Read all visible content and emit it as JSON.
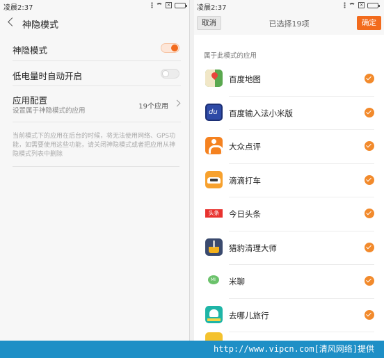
{
  "left": {
    "status_time": "凌晨2:37",
    "title": "神隐模式",
    "rows": [
      {
        "label": "神隐模式"
      },
      {
        "label": "低电量时自动开启"
      },
      {
        "label": "应用配置",
        "sublabel": "设置属于神隐模式的应用",
        "count": "19个应用"
      }
    ],
    "toggles": {
      "stealth_mode": true,
      "low_battery_auto": false
    },
    "description": "当前模式下的应用在后台的时候，将无法使用网络、GPS功能，如需要使用这些功能，请关闭神隐模式或者把应用从神隐模式列表中删除"
  },
  "right": {
    "status_time": "凌晨2:37",
    "cancel_label": "取消",
    "title": "已选择19项",
    "ok_label": "确定",
    "section_label": "属于此模式的应用",
    "apps": [
      {
        "name": "百度地图",
        "icon": "baidu-map-icon",
        "checked": true
      },
      {
        "name": "百度输入法小米版",
        "icon": "baidu-input-icon",
        "checked": true,
        "icon_text": "du"
      },
      {
        "name": "大众点评",
        "icon": "dianping-icon",
        "checked": true
      },
      {
        "name": "滴滴打车",
        "icon": "didi-icon",
        "checked": true
      },
      {
        "name": "今日头条",
        "icon": "toutiao-icon",
        "checked": true,
        "icon_text": "头条"
      },
      {
        "name": "猎豹清理大师",
        "icon": "cheetah-clean-icon",
        "checked": true
      },
      {
        "name": "米聊",
        "icon": "miliao-icon",
        "checked": true,
        "icon_text": "MI"
      },
      {
        "name": "去哪儿旅行",
        "icon": "qunar-icon",
        "checked": true
      }
    ]
  },
  "watermark": "http://www.vipcn.com[清风网络]提供",
  "colors": {
    "accent": "#f26b1d",
    "check": "#f28a2c",
    "watermark_bg": "#1e8fc6"
  }
}
